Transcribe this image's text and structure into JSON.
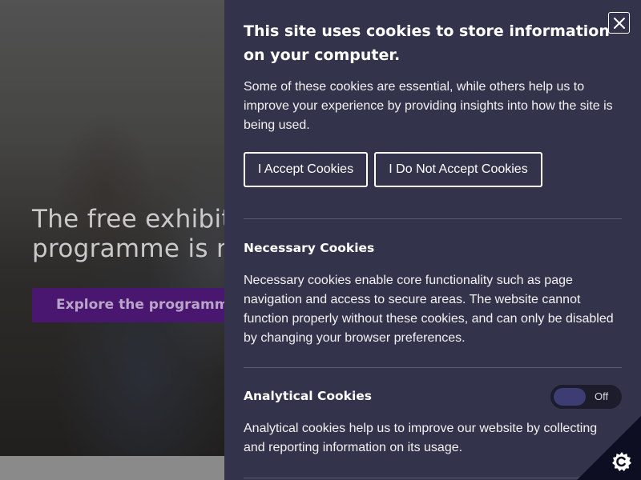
{
  "hero": {
    "heading": "The free exhibition\nprogramme is now live",
    "cta_label": "Explore the programme"
  },
  "cookie_panel": {
    "title": "This site uses cookies to store information on your computer.",
    "intro": "Some of these cookies are essential, while others help us to improve your experience by providing insights into how the site is being used.",
    "accept_label": "I Accept Cookies",
    "decline_label": "I Do Not Accept Cookies",
    "necessary": {
      "title": "Necessary Cookies",
      "text": "Necessary cookies enable core functionality such as page navigation and access to secure areas. The website cannot function properly without these cookies, and can only be disabled by changing your browser preferences."
    },
    "analytical": {
      "title": "Analytical Cookies",
      "text": "Analytical cookies help us to improve our website by collecting and reporting information on its usage.",
      "toggle_state": "Off",
      "enabled": false
    }
  },
  "icons": {
    "close": "close-icon",
    "cookie_settings": "cookie-control-icon"
  },
  "colors": {
    "panel_background": "#33334b",
    "hero_cta": "#4a1770",
    "toggle_knob": "#3d3d74"
  }
}
